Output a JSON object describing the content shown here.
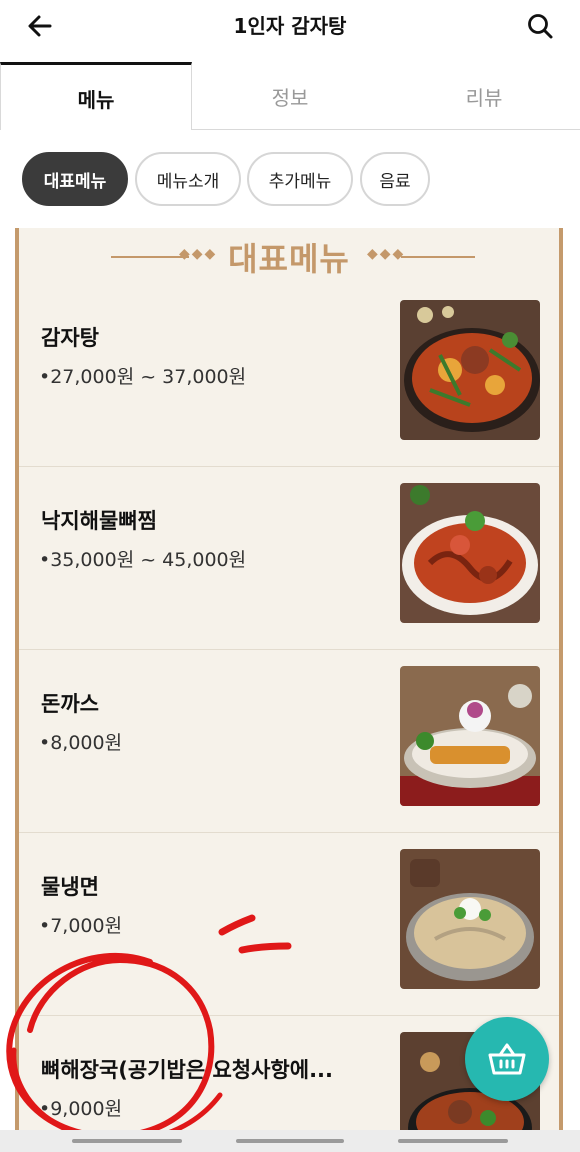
{
  "header": {
    "title": "1인자 감자탕",
    "back_icon": "arrow-left-icon",
    "search_icon": "search-icon"
  },
  "tabs": [
    {
      "label": "메뉴",
      "active": true
    },
    {
      "label": "정보",
      "active": false
    },
    {
      "label": "리뷰",
      "active": false
    }
  ],
  "chips": [
    {
      "label": "대표메뉴",
      "active": true
    },
    {
      "label": "메뉴소개",
      "active": false
    },
    {
      "label": "추가메뉴",
      "active": false
    },
    {
      "label": "음료",
      "active": false
    }
  ],
  "section": {
    "title": "대표메뉴"
  },
  "menu": [
    {
      "name": "감자탕",
      "price": "•27,000원 ~ 37,000원",
      "image": "gamjatang-photo"
    },
    {
      "name": "낙지해물뼈찜",
      "price": "•35,000원 ~ 45,000원",
      "image": "nakji-haemul-ppyeojjim-photo"
    },
    {
      "name": "돈까스",
      "price": "•8,000원",
      "image": "donkatsu-photo"
    },
    {
      "name": "물냉면",
      "price": "•7,000원",
      "image": "mulnaengmyeon-photo"
    },
    {
      "name": "뼈해장국(공기밥은 요청사항에...",
      "price": "•9,000원",
      "image": "ppyeohaejangguk-photo"
    }
  ],
  "cart": {
    "icon": "basket-icon",
    "color": "#26b8b0"
  },
  "colors": {
    "accent": "#c4986a",
    "chip_active": "#3b3b3b",
    "annotation": "#e01818"
  }
}
